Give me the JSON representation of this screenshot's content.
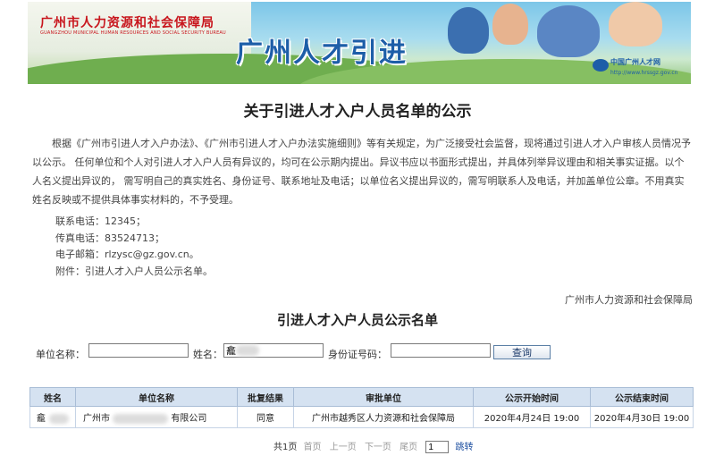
{
  "banner": {
    "bureau_cn": "广州市人力资源和社会保障局",
    "bureau_en": "GUANGZHOU MUNICIPAL HUMAN RESOURCES AND SOCIAL SECURITY BUREAU",
    "slogan": "广州人才引进",
    "logo_name": "中国广州人才网",
    "logo_url": "http://www.hrssgz.gov.cn"
  },
  "notice": {
    "title": "关于引进人才入户人员名单的公示",
    "paragraph": "根据《广州市引进人才入户办法》、《广州市引进人才入户办法实施细则》等有关规定，为广泛接受社会监督，现将通过引进人才入户审核人员情况予以公示。 任何单位和个人对引进人才入户人员有异议的，均可在公示期内提出。异议书应以书面形式提出，并具体列举异议理由和相关事实证据。以个人名义提出异议的， 需写明自己的真实姓名、身份证号、联系地址及电话；以单位名义提出异议的，需写明联系人及电话，并加盖单位公章。不用真实姓名反映或不提供具体事实材料的，不予受理。",
    "contacts": [
      "联系电话：12345；",
      "传真电话：83524713；",
      "电子邮箱：rlzysc@gz.gov.cn。",
      "附件：引进人才入户人员公示名单。"
    ],
    "issuer": "广州市人力资源和社会保障局"
  },
  "list": {
    "title": "引进人才入户人员公示名单"
  },
  "search": {
    "unit_label": "单位名称：",
    "unit_value": "",
    "name_label": "姓名：",
    "name_value": "龕",
    "id_label": "身份证号码：",
    "id_value": "",
    "button": "查询"
  },
  "table": {
    "headers": [
      "姓名",
      "单位名称",
      "批复结果",
      "审批单位",
      "公示开始时间",
      "公示结束时间"
    ],
    "rows": [
      {
        "name": "龕",
        "unit_prefix": "广州市",
        "unit_suffix": "有限公司",
        "result": "同意",
        "approver": "广州市越秀区人力资源和社会保障局",
        "start": "2020年4月24日 19:00",
        "end": "2020年4月30日 19:00"
      }
    ]
  },
  "pager": {
    "total": "共1页",
    "first": "首页",
    "prev": "上一页",
    "next": "下一页",
    "last": "尾页",
    "page_value": "1",
    "jump": "跳转"
  },
  "colors": {
    "bureau_red": "#c8161d",
    "slogan_blue": "#1d5ea8",
    "table_header_bg": "#d5e2f1"
  }
}
